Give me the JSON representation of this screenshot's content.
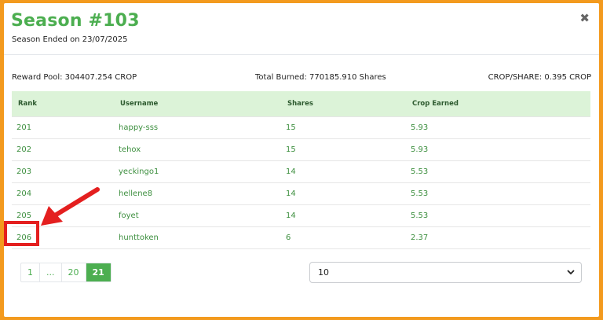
{
  "modal": {
    "title": "Season #103",
    "subtitle": "Season Ended on 23/07/2025",
    "close_icon": "close-icon"
  },
  "stats": {
    "reward_pool": "Reward Pool: 304407.254 CROP",
    "total_burned": "Total Burned: 770185.910 Shares",
    "crop_per_share": "CROP/SHARE: 0.395 CROP"
  },
  "table": {
    "headers": [
      "Rank",
      "Username",
      "Shares",
      "Crop Earned"
    ],
    "rows": [
      [
        "201",
        "happy-sss",
        "15",
        "5.93"
      ],
      [
        "202",
        "tehox",
        "15",
        "5.93"
      ],
      [
        "203",
        "yeckingo1",
        "14",
        "5.53"
      ],
      [
        "204",
        "hellene8",
        "14",
        "5.53"
      ],
      [
        "205",
        "foyet",
        "14",
        "5.53"
      ],
      [
        "206",
        "hunttoken",
        "6",
        "2.37"
      ]
    ]
  },
  "pagination": {
    "pages": [
      "1",
      "...",
      "20",
      "21"
    ],
    "active": "21"
  },
  "page_size": {
    "selected": "10"
  },
  "colors": {
    "accent": "#4cae50",
    "header_bg": "#dcf3d8",
    "frame": "#f39a1e",
    "annotation": "#e41f1f"
  }
}
